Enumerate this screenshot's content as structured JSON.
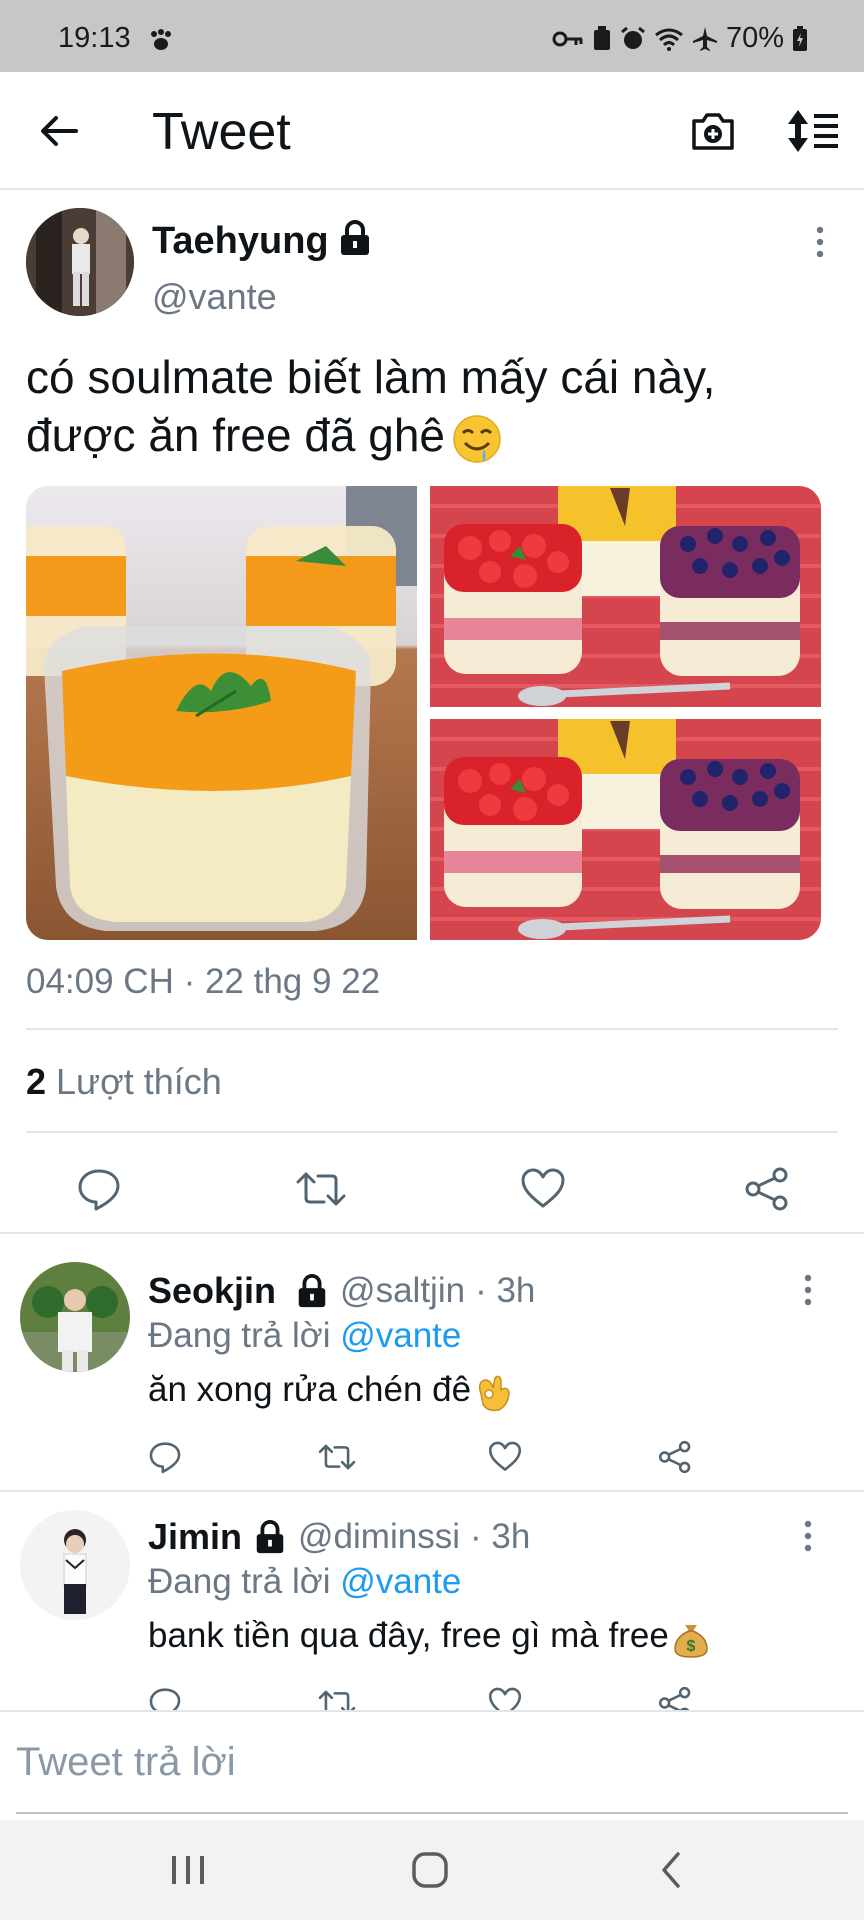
{
  "status_bar": {
    "time": "19:13",
    "battery": "70%"
  },
  "app_bar": {
    "title": "Tweet"
  },
  "tweet": {
    "author_name": "Taehyung",
    "author_handle": "@vante",
    "text_line1": "có soulmate biết làm mấy cái này,",
    "text_line2": "được ăn free đã ghê",
    "timestamp": "04:09 CH · 22 thg 9 22",
    "likes_count": "2",
    "likes_label": " Lượt thích",
    "media": [
      {
        "name": "mango-panna-cotta",
        "icon": "photo"
      },
      {
        "name": "berry-panna-cotta",
        "icon": "photo"
      },
      {
        "name": "berry-panna-cotta-2",
        "icon": "photo"
      }
    ]
  },
  "replies": [
    {
      "name": "Seokjin",
      "handle": "@saltjin",
      "time": "· 3h",
      "replying_prefix": "Đang trả lời ",
      "replying_mention": "@vante",
      "text": "ăn xong rửa chén đê"
    },
    {
      "name": "Jimin",
      "handle": "@diminssi",
      "time": "· 3h",
      "replying_prefix": "Đang trả lời ",
      "replying_mention": "@vante",
      "text": "bank tiền qua đây, free gì mà free"
    }
  ],
  "compose": {
    "placeholder": "Tweet trả lời"
  },
  "colors": {
    "accent": "#1d9bf0",
    "secondary_text": "#6b7784",
    "status_bar": "#c7c7c7"
  }
}
